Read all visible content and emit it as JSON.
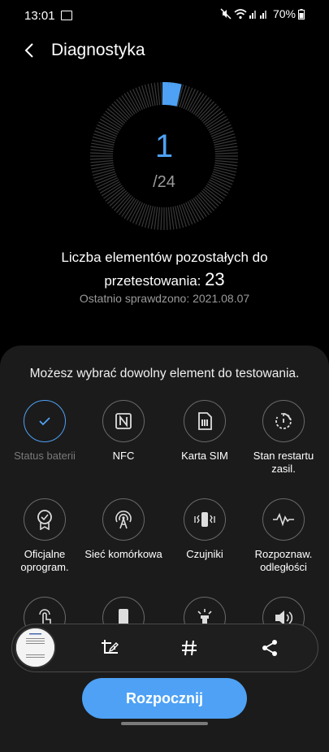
{
  "status_bar": {
    "time": "13:01",
    "battery": "70%",
    "icons": [
      "image-icon",
      "mute-icon",
      "wifi-icon",
      "signal-icon",
      "battery-icon"
    ]
  },
  "app_bar": {
    "title": "Diagnostyka"
  },
  "progress": {
    "count": "1",
    "total": "/24",
    "fraction_complete": 0.0417,
    "accent_color": "#4ea1f5"
  },
  "summary": {
    "remaining_text": "Liczba elementów pozostałych do przetestowania:",
    "remaining_count": "23",
    "last_checked": "Ostatnio sprawdzono: 2021.08.07"
  },
  "panel": {
    "hint": "Możesz wybrać dowolny element do testowania.",
    "items": [
      {
        "label": "Status baterii",
        "icon": "check-icon",
        "selected": true
      },
      {
        "label": "NFC",
        "icon": "nfc-icon"
      },
      {
        "label": "Karta SIM",
        "icon": "sim-card-icon"
      },
      {
        "label": "Stan restartu zasil.",
        "icon": "restart-icon"
      },
      {
        "label": "Oficjalne oprogram.",
        "icon": "certified-badge-icon"
      },
      {
        "label": "Sieć komórkowa",
        "icon": "antenna-icon"
      },
      {
        "label": "Czujniki",
        "icon": "vibration-sensor-icon"
      },
      {
        "label": "Rozpoznaw. odległości",
        "icon": "pulse-icon"
      },
      {
        "label": "",
        "icon": "touch-icon"
      },
      {
        "label": "",
        "icon": "phone-icon"
      },
      {
        "label": "",
        "icon": "flashlight-icon"
      },
      {
        "label": "",
        "icon": "speaker-icon"
      }
    ]
  },
  "toolbar": {
    "buttons": [
      "crop-edit-icon",
      "hashtag-icon",
      "share-icon"
    ]
  },
  "start_button": {
    "label": "Rozpocznij"
  }
}
